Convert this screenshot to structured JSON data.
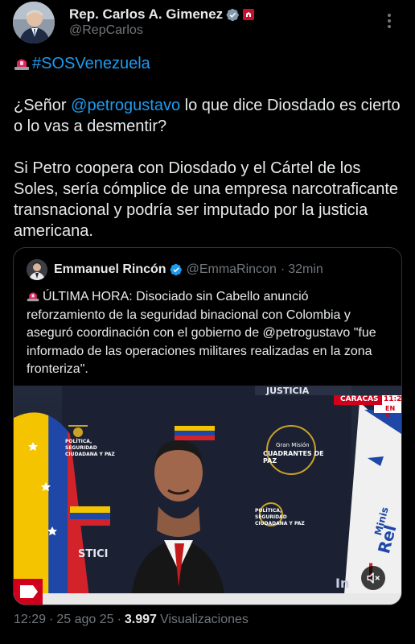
{
  "author": {
    "display_name": "Rep. Carlos A. Gimenez",
    "handle": "@RepCarlos"
  },
  "tweet": {
    "hashtag": "#SOSVenezuela",
    "line1_prefix": "¿Señor ",
    "mention": "@petrogustavo",
    "line1_suffix": " lo que dice Diosdado es cierto",
    "line2": "o lo vas a desmentir?",
    "para2": [
      "Si Petro coopera con Diosdado y el Cártel de los",
      "Soles, sería cómplice de una empresa narcotraficante",
      "transnacional y podría ser imputado por la justicia",
      "americana."
    ]
  },
  "quote": {
    "display_name": "Emmanuel Rincón",
    "handle": "@EmmaRincon",
    "separator": "·",
    "time": "32min",
    "line1": "ÚLTIMA HORA: Disociado sin Cabello anunció",
    "line2": "reforzamiento de la seguridad binacional con Colombia y",
    "line3_prefix": "aseguró coordinación con el gobierno de ",
    "line3_mention": "@petrogustavo",
    "line3_suffix": " \"fue",
    "line4": "informado de las operaciones militares realizadas en la zona",
    "line5": "fronteriza\".",
    "video": {
      "banner_top": "JUSTICIA",
      "caption": "CARACAS",
      "clock": "11:2",
      "corner": "EN V",
      "sign_left": "POLÍTICA, SEGURIDAD CIUDADANA Y PAZ",
      "sign_center_1": "Gran Misión",
      "sign_center_2": "CUADRANTES DE PAZ",
      "sign_right": "POLÍTICA, SEGURIDAD CIUDADANA Y PAZ",
      "wall_text": "STICI",
      "flag_text_1": "Minis",
      "flag_text_2": "Rel",
      "flag_text_3": "J",
      "logo_text": "In"
    }
  },
  "footer": {
    "time": "12:29",
    "dot": "·",
    "date": "25 ago 25",
    "views_count": "3.997",
    "views_label": "Visualizaciones"
  },
  "colors": {
    "background": "#000000",
    "text": "#e7e9ea",
    "muted": "#71767b",
    "link": "#1d9bf0",
    "border": "#2f3336",
    "siren": "#e0245e"
  }
}
